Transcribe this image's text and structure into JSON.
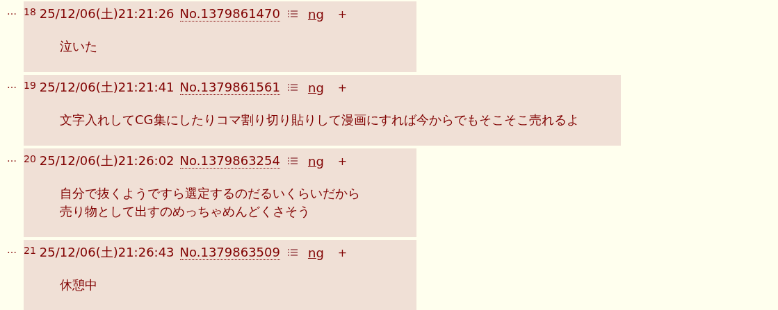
{
  "posts": [
    {
      "marker": "…",
      "number": "18",
      "datetime": "25/12/06(土)21:21:26",
      "post_no": "No.1379861470",
      "ng": "ng",
      "plus": "+",
      "lines": [
        "泣いた"
      ]
    },
    {
      "marker": "…",
      "number": "19",
      "datetime": "25/12/06(土)21:21:41",
      "post_no": "No.1379861561",
      "ng": "ng",
      "plus": "+",
      "lines": [
        "文字入れしてCG集にしたりコマ割り切り貼りして漫画にすれば今からでもそこそこ売れるよ"
      ]
    },
    {
      "marker": "…",
      "number": "20",
      "datetime": "25/12/06(土)21:26:02",
      "post_no": "No.1379863254",
      "ng": "ng",
      "plus": "+",
      "lines": [
        "自分で抜くようですら選定するのだるいくらいだから",
        "売り物として出すのめっちゃめんどくさそう"
      ]
    },
    {
      "marker": "…",
      "number": "21",
      "datetime": "25/12/06(土)21:26:43",
      "post_no": "No.1379863509",
      "ng": "ng",
      "plus": "+",
      "lines": [
        "休憩中"
      ]
    }
  ]
}
